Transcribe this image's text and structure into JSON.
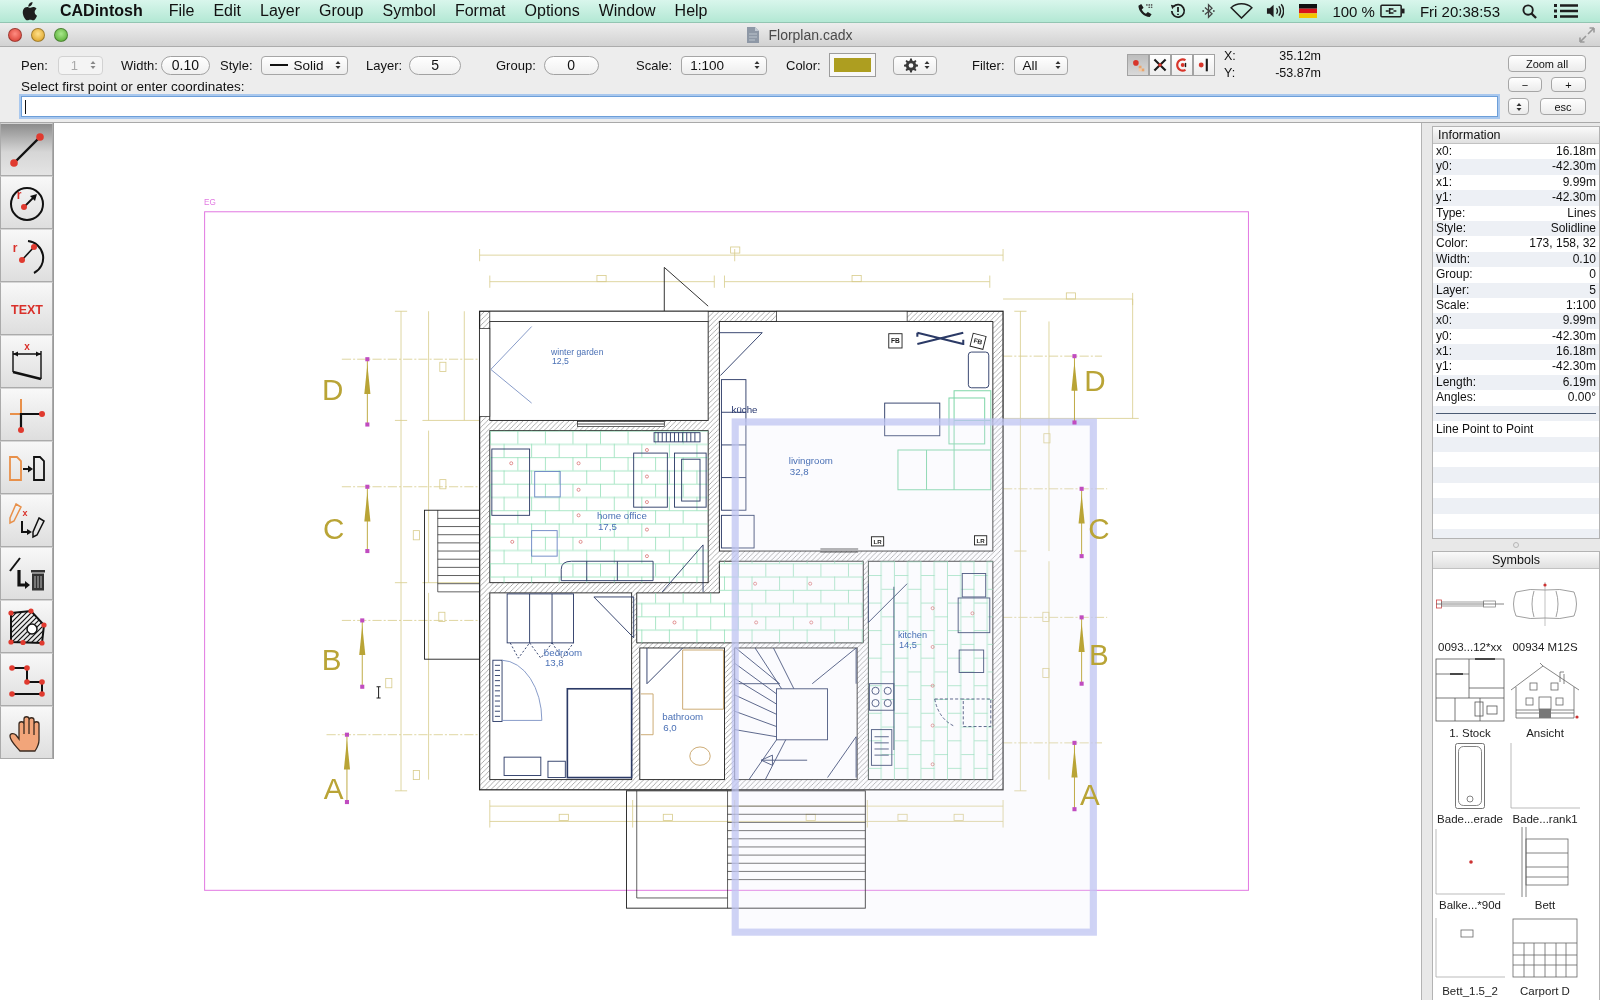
{
  "menu_bar": {
    "app_name": "CADintosh",
    "menus": [
      "File",
      "Edit",
      "Layer",
      "Group",
      "Symbol",
      "Format",
      "Options",
      "Window",
      "Help"
    ],
    "battery": "100 %",
    "clock": "Fri 20:38:53"
  },
  "window": {
    "title": "Florplan.cadx"
  },
  "toolbar": {
    "pen": {
      "label": "Pen:",
      "value": "1",
      "disabled": true
    },
    "width": {
      "label": "Width:",
      "value": "0.10"
    },
    "style": {
      "label": "Style:",
      "value": "Solid"
    },
    "layer": {
      "label": "Layer:",
      "value": "5"
    },
    "group": {
      "label": "Group:",
      "value": "0"
    },
    "scale": {
      "label": "Scale:",
      "value": "1:100"
    },
    "color": {
      "label": "Color:",
      "color": "#ad9e20"
    },
    "filter": {
      "label": "Filter:",
      "value": "All"
    },
    "snap_modes": [
      {
        "selected": true
      },
      {
        "selected": false
      },
      {
        "selected": false
      },
      {
        "selected": false
      }
    ],
    "coordinates": [
      {
        "label": "X:",
        "value": "35.12m"
      },
      {
        "label": "Y:",
        "value": "-53.87m"
      }
    ],
    "buttons": [
      "Zoom all",
      "−",
      "+",
      "esc"
    ]
  },
  "command_line": {
    "prompt": "Select first point or enter coordinates:"
  },
  "tools": [
    {
      "selected": true
    },
    {
      "selected": false,
      "glyph": "r"
    },
    {
      "selected": false,
      "glyph": "r"
    },
    {
      "selected": false,
      "glyph": "TEXT"
    },
    {
      "selected": false,
      "glyph": "x"
    },
    {
      "selected": false
    },
    {
      "selected": false
    },
    {
      "selected": false,
      "glyph": "x"
    },
    {
      "selected": false
    },
    {
      "selected": false
    },
    {
      "selected": false
    },
    {
      "selected": false
    }
  ],
  "canvas": {
    "sheet_label": "EG",
    "rooms": [
      {
        "name": "winter garden",
        "area": "12,5"
      },
      {
        "name": "küche"
      },
      {
        "name": "livingroom",
        "area": "32,8"
      },
      {
        "name": "home office",
        "area": "17,5"
      },
      {
        "name": "bedroom",
        "area": "13,8"
      },
      {
        "name": "bathroom",
        "area": "6,0"
      },
      {
        "name": "kitchen",
        "area": "14,5"
      }
    ],
    "tags": [
      "FB",
      "FB",
      "LR",
      "LR"
    ],
    "section_marks": {
      "left": [
        "D",
        "C",
        "B",
        "A"
      ],
      "right": [
        "D",
        "C",
        "B",
        "A"
      ]
    }
  },
  "information": {
    "title": "Information",
    "rows": [
      {
        "label": "x0:",
        "value": "16.18m"
      },
      {
        "label": "y0:",
        "value": "-42.30m"
      },
      {
        "label": "x1:",
        "value": "9.99m"
      },
      {
        "label": "y1:",
        "value": "-42.30m"
      },
      {
        "label": "Type:",
        "value": "Lines"
      },
      {
        "label": "Style:",
        "value": "Solidline"
      },
      {
        "label": "Color:",
        "value": "173, 158, 32"
      },
      {
        "label": "Width:",
        "value": "0.10"
      },
      {
        "label": "Group:",
        "value": "0"
      },
      {
        "label": "Layer:",
        "value": "5"
      },
      {
        "label": "Scale:",
        "value": "1:100"
      },
      {
        "label": "x0:",
        "value": "9.99m"
      },
      {
        "label": "y0:",
        "value": "-42.30m"
      },
      {
        "label": "x1:",
        "value": "16.18m"
      },
      {
        "label": "y1:",
        "value": "-42.30m"
      },
      {
        "label": "Length:",
        "value": "6.19m"
      },
      {
        "label": "Angles:",
        "value": "0.00°"
      }
    ],
    "description": "Line Point to Point"
  },
  "symbols": {
    "title": "Symbols",
    "items": [
      {
        "kind": "rod",
        "label": "0093...12*xx"
      },
      {
        "kind": "car",
        "label": "00934 M12S"
      },
      {
        "kind": "floorplan",
        "label": "1. Stock"
      },
      {
        "kind": "house",
        "label": "Ansicht"
      },
      {
        "kind": "bathtub",
        "label": "Bade...erade"
      },
      {
        "kind": "frame",
        "label": "Bade...rank1"
      },
      {
        "kind": "point",
        "label": "Balke...*90d"
      },
      {
        "kind": "bed",
        "label": "Bett"
      },
      {
        "kind": "box",
        "label": "Bett_1.5_2"
      },
      {
        "kind": "grid",
        "label": "Carport D"
      }
    ]
  }
}
